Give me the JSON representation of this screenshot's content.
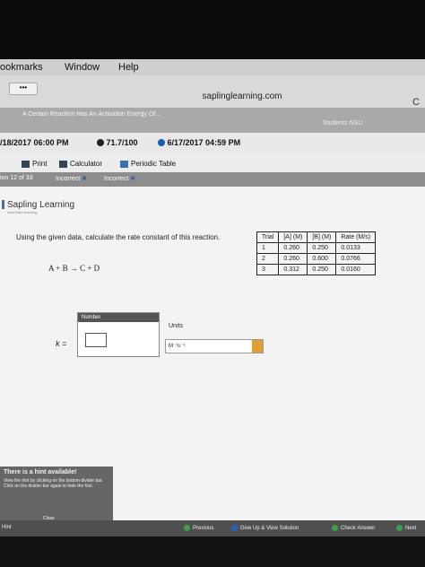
{
  "menu": {
    "items": [
      "ookmarks",
      "Window",
      "Help"
    ]
  },
  "browser": {
    "tab_button": "•••",
    "url": "saplinglearning.com",
    "reload": "C"
  },
  "tabs": {
    "tab1": "A Certain Reaction Has An Activation Energy Of...",
    "tab2": "Students NSU"
  },
  "infobar": {
    "start_date": "/18/2017 06:00 PM",
    "score": "71.7/100",
    "due_date": "6/17/2017 04:59 PM"
  },
  "toolbar": {
    "print": "Print",
    "calculator": "Calculator",
    "periodic": "Periodic Table"
  },
  "qnav": {
    "question_of": "ion 12 of 33",
    "incorrect1": "Incorrect",
    "incorrect2": "Incorrect"
  },
  "content": {
    "logo": "Sapling Learning",
    "logo_tag": "macmillan learning",
    "question": "Using the given data, calculate the rate constant of this reaction.",
    "reaction": "A + B  →  C + D",
    "table": {
      "headers": [
        "Trial",
        "[A] (M)",
        "[B] (M)",
        "Rate (M/s)"
      ],
      "rows": [
        [
          "1",
          "0.260",
          "0.250",
          "0.0133"
        ],
        [
          "2",
          "0.260",
          "0.600",
          "0.0766"
        ],
        [
          "3",
          "0.312",
          "0.250",
          "0.0160"
        ]
      ]
    },
    "number_label": "Number",
    "k_label": "k =",
    "units_label": "Units",
    "units_value": "M⁻¹s⁻¹",
    "hint_title": "There is a hint available!",
    "hint_body": "View the hint by clicking on the bottom divider bar. Click on the divider bar again to hide the hint.",
    "hint_close": "Close"
  },
  "footer": {
    "hint_tab": "Hint",
    "previous": "Previous",
    "give_up": "Give Up & View Solution",
    "check": "Check Answer",
    "next": "Next"
  }
}
